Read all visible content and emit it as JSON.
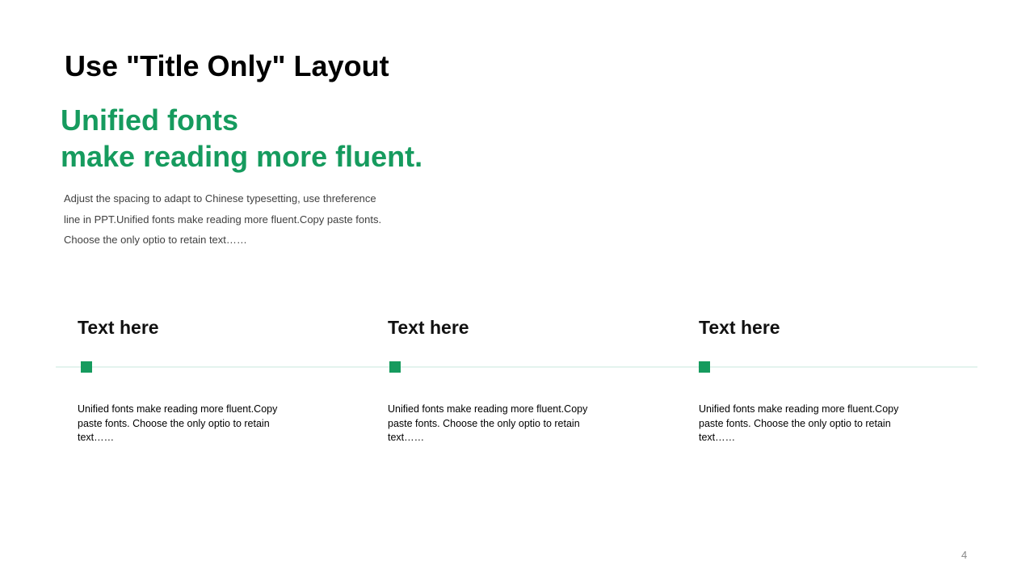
{
  "colors": {
    "accent": "#169b5e",
    "marker": "#169b5e",
    "timeline_line": "#e3f3ee"
  },
  "slide": {
    "title": "Use \"Title Only\" Layout",
    "subtitle_lines": [
      "Unified fonts",
      "make reading more fluent."
    ],
    "description_lines": [
      "Adjust the spacing to adapt to Chinese typesetting, use threference",
      "line in PPT.Unified fonts make reading more fluent.Copy paste fonts.",
      "Choose the only optio to retain text……"
    ],
    "page_number": "4"
  },
  "items": [
    {
      "title": "Text here",
      "text_lines": [
        "Unified  fonts make reading more fluent.Copy",
        "paste fonts. Choose  the only  optio to retain",
        "text……"
      ]
    },
    {
      "title": "Text here",
      "text_lines": [
        "Unified  fonts make reading more fluent.Copy",
        "paste fonts. Choose  the only  optio to retain",
        "text……"
      ]
    },
    {
      "title": "Text here",
      "text_lines": [
        "Unified  fonts make reading more fluent.Copy",
        "paste fonts. Choose  the only  optio to retain",
        "text……"
      ]
    }
  ]
}
